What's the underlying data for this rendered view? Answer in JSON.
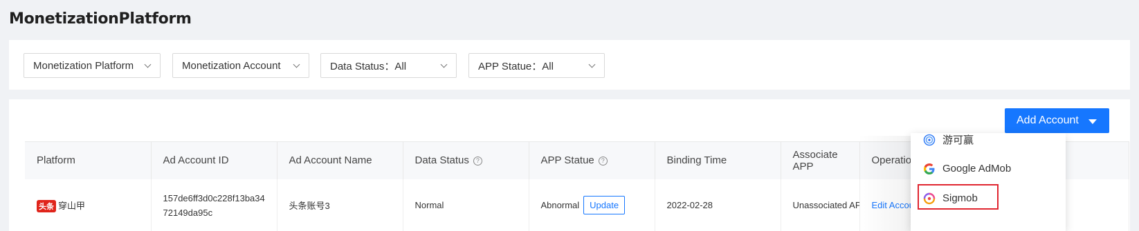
{
  "page": {
    "title": "MonetizationPlatform"
  },
  "filters": [
    {
      "label": "Monetization Platform"
    },
    {
      "label": "Monetization Account"
    },
    {
      "label": "Data Status：All"
    },
    {
      "label": "APP Statue：All"
    }
  ],
  "toolbar": {
    "add_account_label": "Add Account"
  },
  "table": {
    "columns": [
      "Platform",
      "Ad Account ID",
      "Ad Account Name",
      "Data Status",
      "APP Statue",
      "Binding Time",
      "Associate APP",
      "Operation"
    ],
    "rows": [
      {
        "platform_badge": "头条",
        "platform_name": "穿山甲",
        "account_id_line1": "157de6ff3d0c228f13ba34",
        "account_id_line2": "72149da95c",
        "account_name": "头条账号3",
        "data_status": "Normal",
        "app_statue": "Abnormal",
        "update_label": "Update",
        "binding_time": "2022-02-28",
        "associate_app": "Unassociated APP",
        "operation": "Edit Account"
      }
    ]
  },
  "dropdown": {
    "items": [
      {
        "label": "游可赢",
        "icon": "youkeying-icon"
      },
      {
        "label": "Google AdMob",
        "icon": "google-icon"
      },
      {
        "label": "Sigmob",
        "icon": "sigmob-icon"
      }
    ]
  },
  "colors": {
    "accent": "#1677ff",
    "highlight": "#e0252f",
    "badge": "#e0251b"
  }
}
